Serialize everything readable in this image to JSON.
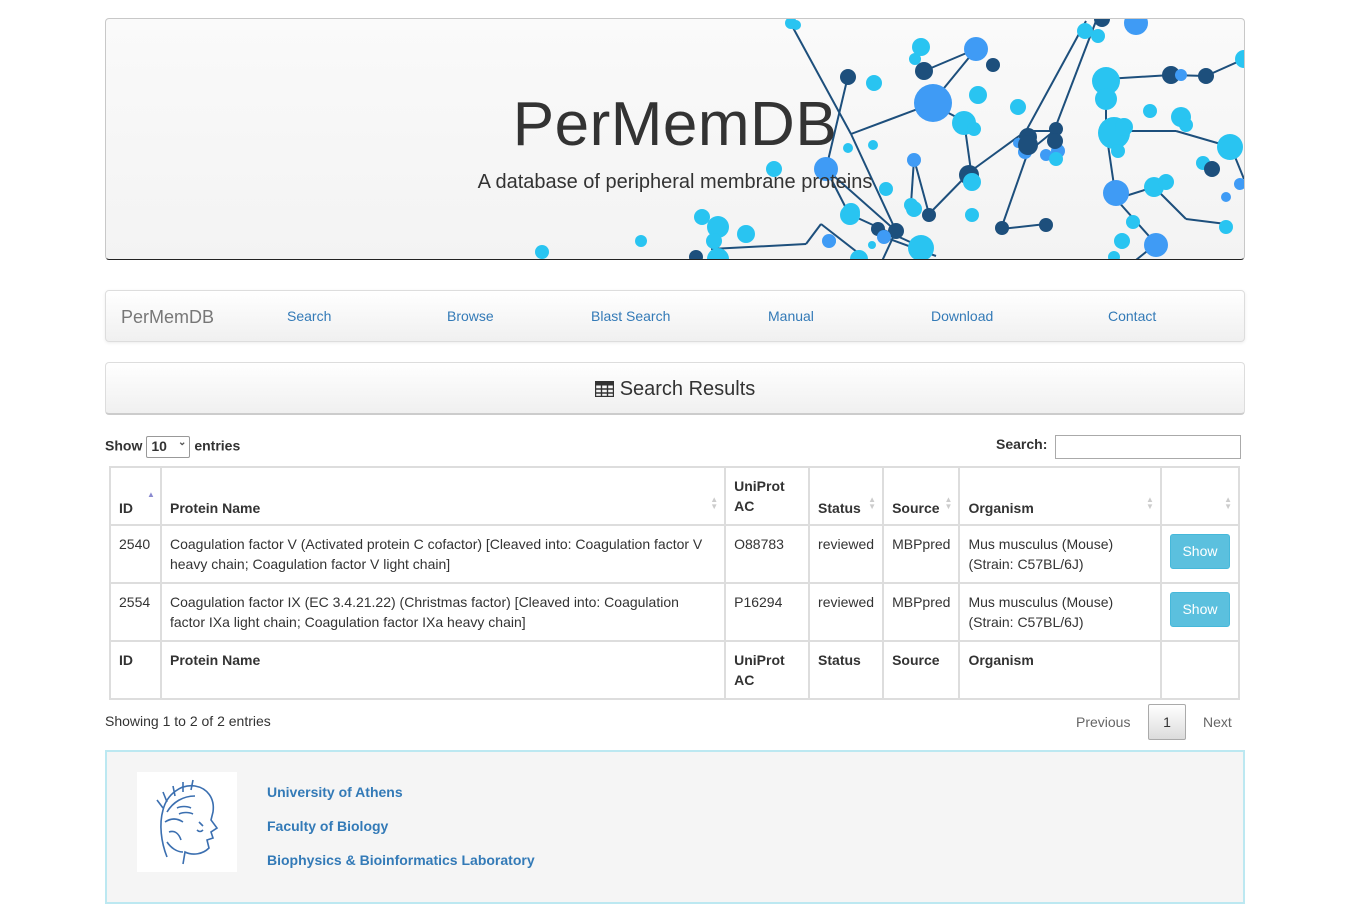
{
  "banner": {
    "title": "PerMemDB",
    "subtitle": "A database of peripheral membrane proteins"
  },
  "navbar": {
    "brand": "PerMemDB",
    "items": [
      {
        "label": "Search"
      },
      {
        "label": "Browse"
      },
      {
        "label": "Blast Search"
      },
      {
        "label": "Manual"
      },
      {
        "label": "Download"
      },
      {
        "label": "Contact"
      }
    ]
  },
  "results_panel": {
    "title": "Search Results",
    "icon": "table-icon"
  },
  "table_controls": {
    "show_label": "Show",
    "entries_label": "entries",
    "page_length": "10",
    "search_label": "Search:",
    "search_value": ""
  },
  "table": {
    "columns": [
      "ID",
      "Protein Name",
      "UniProt AC",
      "Status",
      "Source",
      "Organism",
      ""
    ],
    "rows": [
      {
        "id": "2540",
        "protein_name": "Coagulation factor V (Activated protein C cofactor) [Cleaved into: Coagulation factor V heavy chain; Coagulation factor V light chain]",
        "uniprot_ac": "O88783",
        "status": "reviewed",
        "source": "MBPpred",
        "organism": "Mus musculus (Mouse) (Strain: C57BL/6J)",
        "action": "Show"
      },
      {
        "id": "2554",
        "protein_name": "Coagulation factor IX (EC 3.4.21.22) (Christmas factor) [Cleaved into: Coagulation factor IXa light chain; Coagulation factor IXa heavy chain]",
        "uniprot_ac": "P16294",
        "status": "reviewed",
        "source": "MBPpred",
        "organism": "Mus musculus (Mouse) (Strain: C57BL/6J)",
        "action": "Show"
      }
    ]
  },
  "table_info": "Showing 1 to 2 of 2 entries",
  "pagination": {
    "previous": "Previous",
    "current": "1",
    "next": "Next"
  },
  "footer": {
    "links": [
      {
        "label": "University of Athens"
      },
      {
        "label": "Faculty of Biology"
      },
      {
        "label": "Biophysics & Bioinformatics Laboratory"
      }
    ]
  },
  "colors": {
    "link": "#337ab7",
    "show_button": "#5bc0de",
    "footer_border": "#bce8f1"
  }
}
